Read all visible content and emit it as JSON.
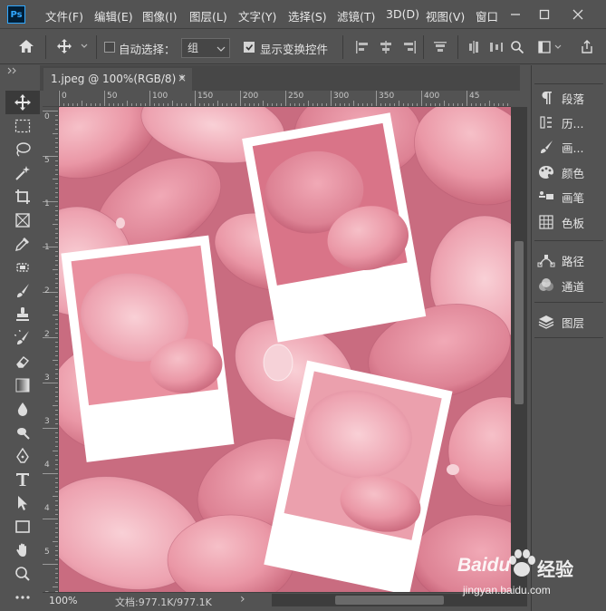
{
  "app": {
    "logo_text": "Ps",
    "menu": [
      "文件(F)",
      "编辑(E)",
      "图像(I)",
      "图层(L)",
      "文字(Y)",
      "选择(S)",
      "滤镜(T)",
      "3D(D)",
      "视图(V)",
      "窗口"
    ]
  },
  "options_bar": {
    "auto_select_label": "自动选择：",
    "auto_select_value": "组",
    "show_transform_label": "显示变换控件"
  },
  "document": {
    "tab_title": "1.jpeg @ 100%(RGB/8) *",
    "tab_close": "×"
  },
  "rulers": {
    "top": [
      "0",
      "50",
      "100",
      "150",
      "200",
      "250",
      "300",
      "350",
      "400",
      "45"
    ],
    "left": [
      "0",
      "5",
      "1",
      "1",
      "2",
      "2",
      "3",
      "3",
      "4",
      "4",
      "5",
      "5"
    ]
  },
  "status": {
    "zoom": "100%",
    "doc_info": "文档:977.1K/977.1K",
    "arrow": "›"
  },
  "panels": [
    {
      "label": "段落",
      "icon": "paragraph-icon"
    },
    {
      "label": "历...",
      "icon": "history-icon"
    },
    {
      "label": "画...",
      "icon": "brush-settings-icon"
    },
    {
      "label": "颜色",
      "icon": "color-icon"
    },
    {
      "label": "画笔",
      "icon": "brushes-icon"
    },
    {
      "label": "色板",
      "icon": "swatches-icon"
    },
    {
      "label": "路径",
      "icon": "paths-icon"
    },
    {
      "label": "通道",
      "icon": "channels-icon"
    },
    {
      "label": "图层",
      "icon": "layers-icon"
    }
  ],
  "watermark": {
    "brand": "Baidu",
    "site": "经验",
    "url": "jingyan.baidu.com"
  },
  "colors": {
    "ui_bg": "#535353",
    "ps_blue": "#31a8ff",
    "petal": "#e28b9a"
  }
}
